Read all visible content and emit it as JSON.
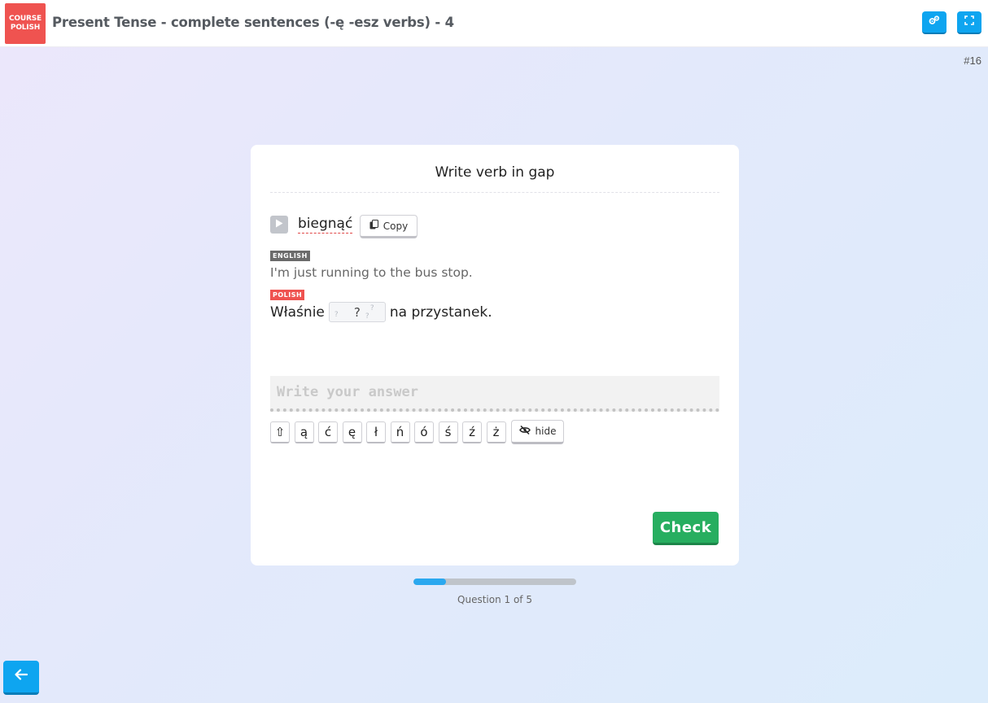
{
  "header": {
    "logo_line1": "COURSE",
    "logo_line2": "POLISH",
    "title": "Present Tense - complete sentences (-ę -esz verbs) - 4",
    "settings_icon": "gears-icon",
    "fullscreen_icon": "fullscreen-icon"
  },
  "counter": "#16",
  "card": {
    "instruction": "Write verb in gap",
    "verb": "biegnąć",
    "copy_label": "Copy",
    "english_tag": "ENGLISH",
    "english_sentence": "I'm just running to the bus stop.",
    "polish_tag": "POLISH",
    "polish_before": "Właśnie",
    "gap_label": "?",
    "polish_after": "na przystanek.",
    "answer_placeholder": "Write your answer",
    "answer_value": "",
    "special_keys": [
      "⇧",
      "ą",
      "ć",
      "ę",
      "ł",
      "ń",
      "ó",
      "ś",
      "ź",
      "ż"
    ],
    "hide_label": "hide",
    "check_label": "Check"
  },
  "progress": {
    "fraction": 0.2,
    "label": "Question 1 of 5",
    "fill_color": "#2ba8ef",
    "track_color": "#bfc4ca"
  },
  "colors": {
    "accent": "#0ea5f0",
    "brand_red": "#ef5350",
    "check_green": "#27ae60"
  }
}
